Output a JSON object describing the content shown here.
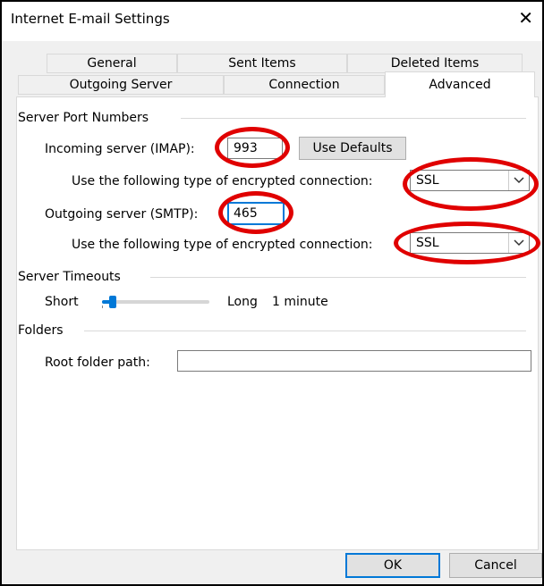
{
  "window": {
    "title": "Internet E-mail Settings",
    "close_glyph": "✕"
  },
  "tabs": {
    "general": "General",
    "sent_items": "Sent Items",
    "deleted_items": "Deleted Items",
    "outgoing_server": "Outgoing Server",
    "connection": "Connection",
    "advanced": "Advanced"
  },
  "server_ports": {
    "group_label": "Server Port Numbers",
    "incoming_label": "Incoming server (IMAP):",
    "incoming_value": "993",
    "use_defaults": "Use Defaults",
    "incoming_enc_label": "Use the following type of encrypted connection:",
    "incoming_enc_value": "SSL",
    "outgoing_label": "Outgoing server (SMTP):",
    "outgoing_value": "465",
    "outgoing_enc_label": "Use the following type of encrypted connection:",
    "outgoing_enc_value": "SSL"
  },
  "timeouts": {
    "group_label": "Server Timeouts",
    "short_label": "Short",
    "long_label": "Long",
    "value_text": "1 minute",
    "slider_level": 0.1
  },
  "folders": {
    "group_label": "Folders",
    "root_label": "Root folder path:",
    "root_value": ""
  },
  "buttons": {
    "ok": "OK",
    "cancel": "Cancel"
  },
  "annotations": {
    "ring_color": "#e00000"
  },
  "icons": {
    "close": "close-icon",
    "dropdown": "chevron-down-icon"
  }
}
